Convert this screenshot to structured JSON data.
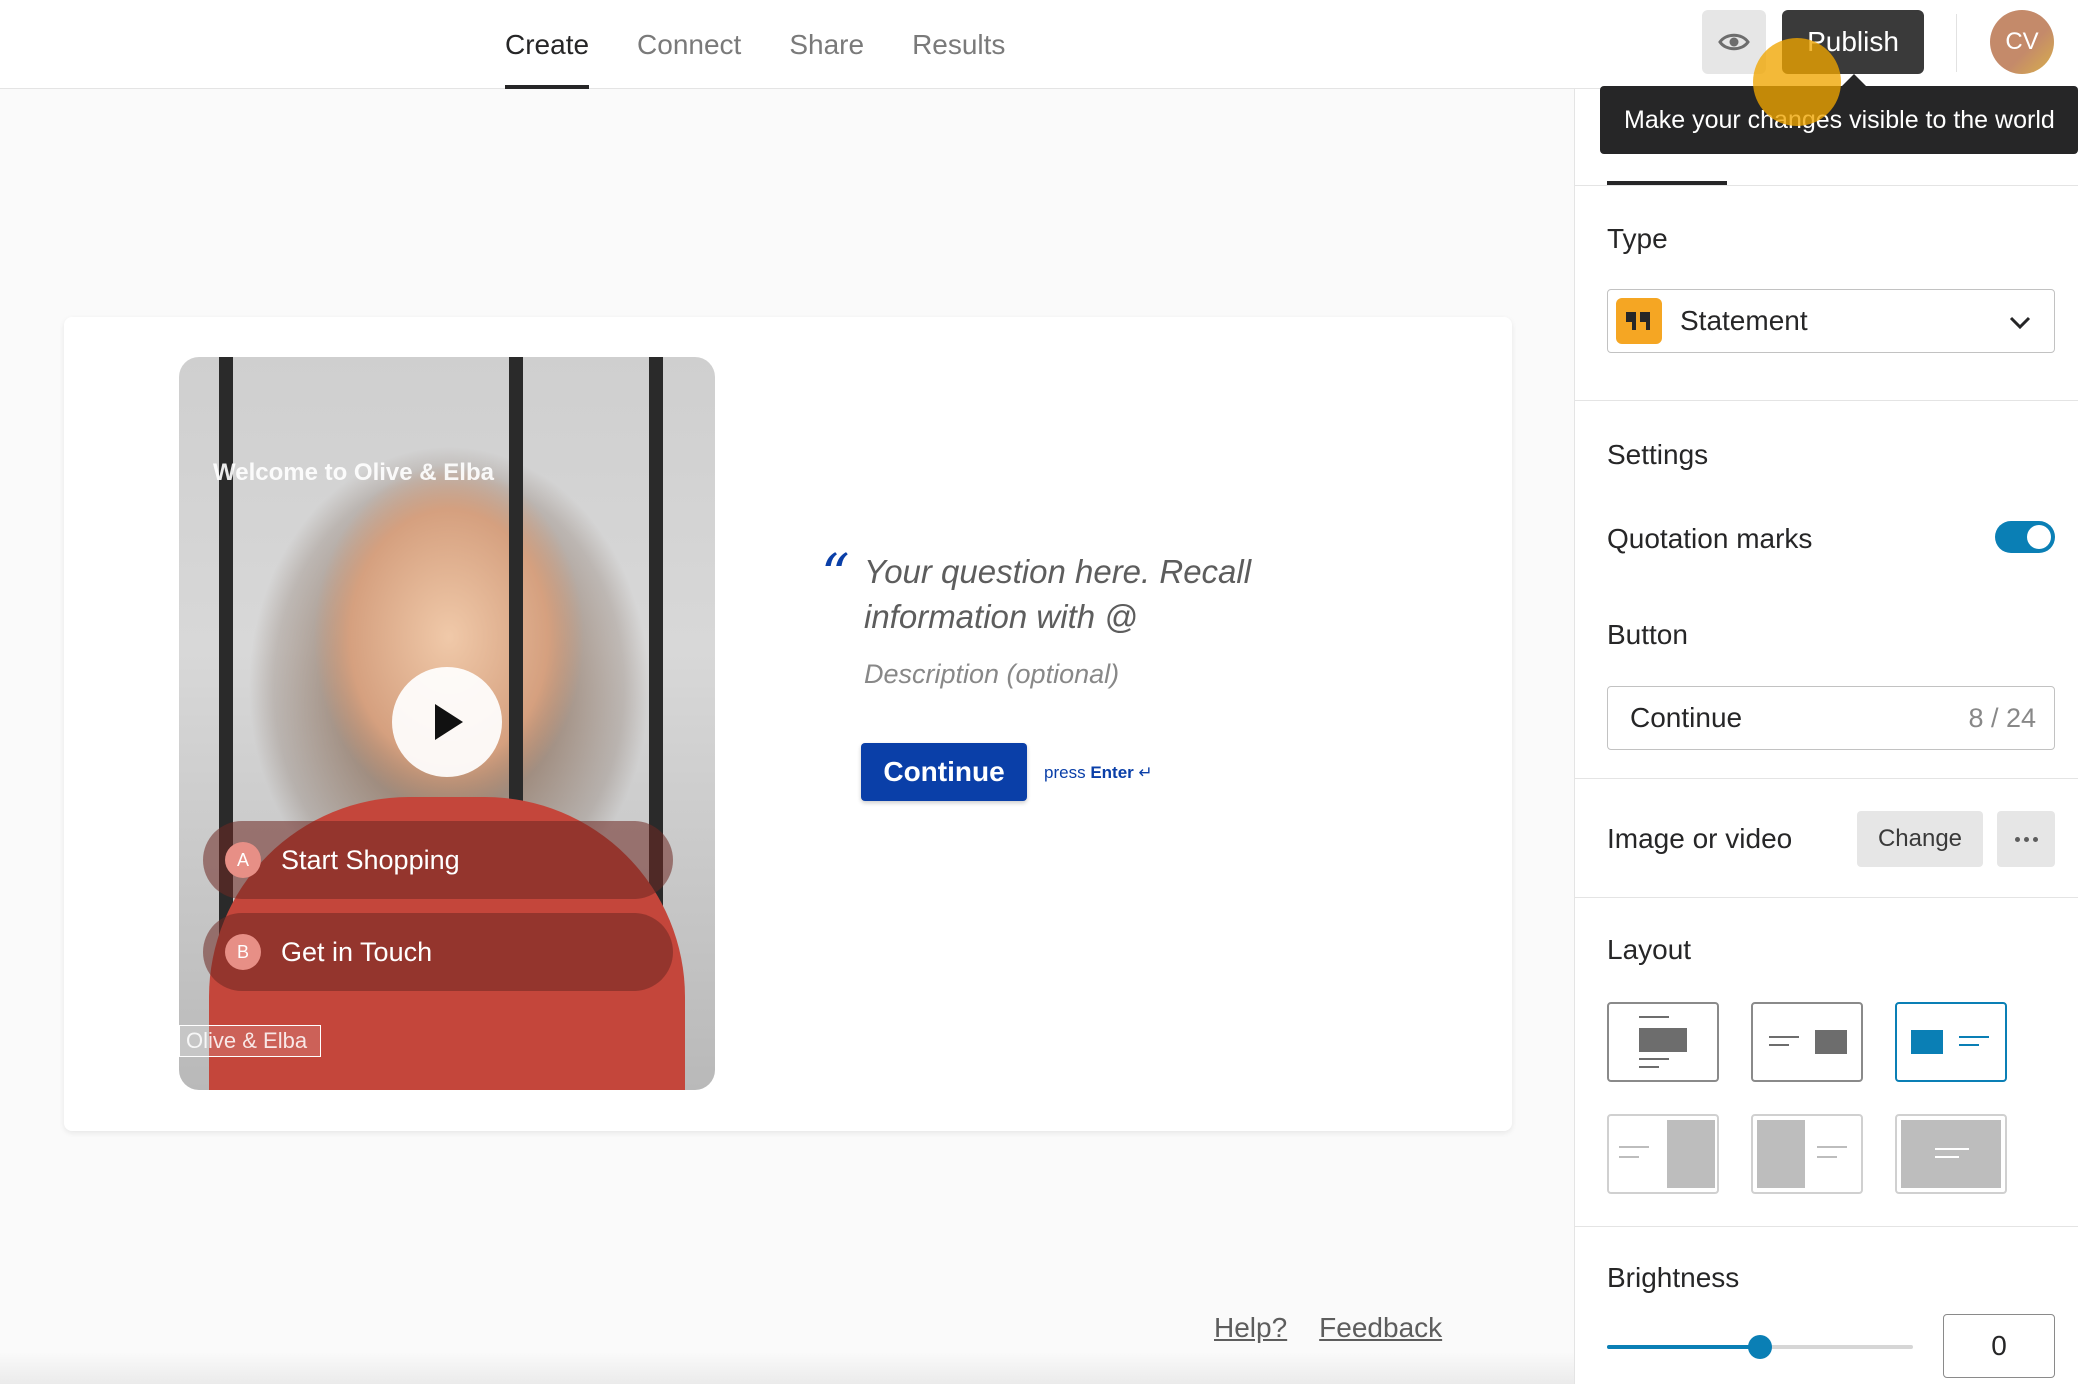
{
  "nav": {
    "tabs": [
      {
        "label": "Create",
        "active": true
      },
      {
        "label": "Connect",
        "active": false
      },
      {
        "label": "Share",
        "active": false
      },
      {
        "label": "Results",
        "active": false
      }
    ],
    "publish_label": "Publish",
    "avatar_initials": "CV",
    "tooltip": "Make your changes visible to the world"
  },
  "canvas": {
    "video_title": "Welcome to Olive & Elba",
    "choices": [
      {
        "key": "A",
        "label": "Start Shopping"
      },
      {
        "key": "B",
        "label": "Get in Touch"
      }
    ],
    "brand_tag": "Olive & Elba",
    "quote_mark": "“",
    "question": "Your question here. Recall information with @",
    "description": "Description (optional)",
    "button_label": "Continue",
    "press_hint_prefix": "press",
    "press_hint_key": "Enter",
    "press_hint_symbol": "↵"
  },
  "footer": {
    "help": "Help?",
    "feedback": "Feedback"
  },
  "panel": {
    "type_heading": "Type",
    "type_value": "Statement",
    "settings_heading": "Settings",
    "quotation_marks_label": "Quotation marks",
    "quotation_marks_on": true,
    "button_heading": "Button",
    "button_value": "Continue",
    "button_char_count": "8 / 24",
    "media_label": "Image or video",
    "change_label": "Change",
    "layout_heading": "Layout",
    "brightness_heading": "Brightness",
    "brightness_value": "0",
    "brightness_fraction": 0.5
  },
  "colors": {
    "accent_blue": "#0a3fa8",
    "toggle_blue": "#0a7fb5",
    "statement_orange": "#f5a623",
    "tooltip_bg": "#262627"
  }
}
